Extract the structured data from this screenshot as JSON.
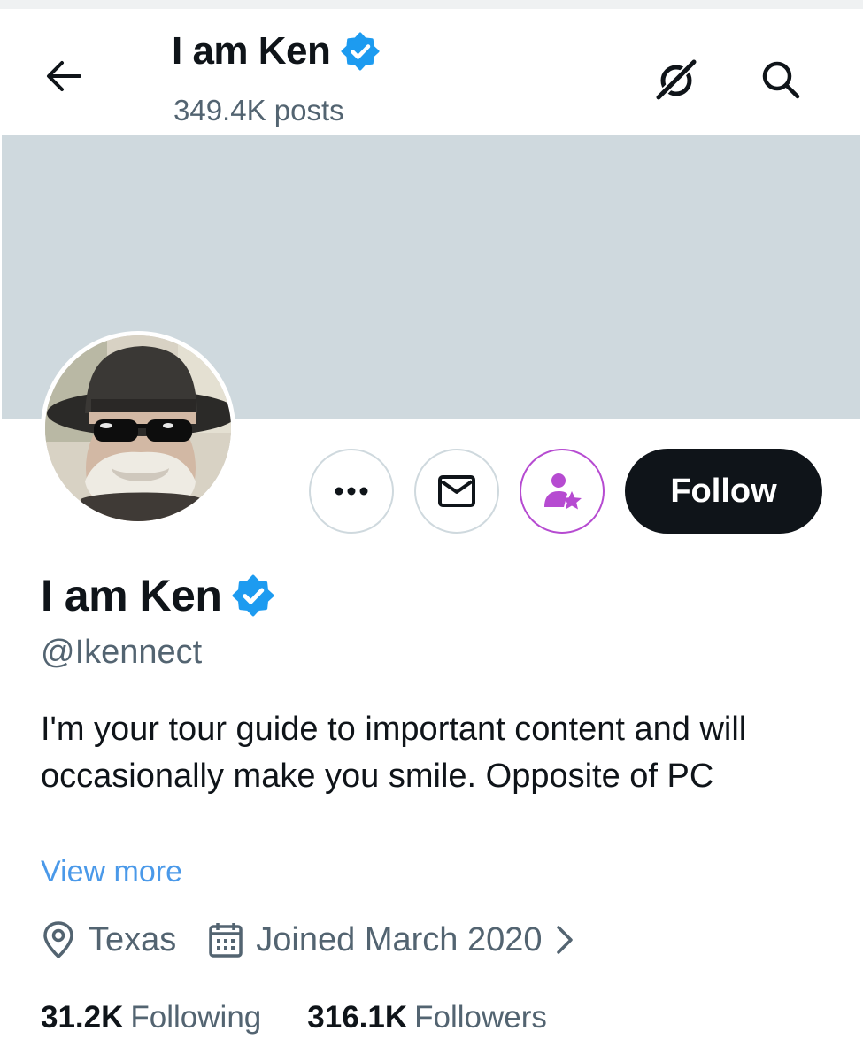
{
  "header": {
    "title": "I am Ken",
    "post_count": "349.4K posts"
  },
  "profile": {
    "display_name": "I am Ken",
    "handle": "@Ikennect",
    "bio": "I'm your tour guide to important content and will occasionally make you smile. Opposite of PC",
    "view_more": "View more",
    "location": "Texas",
    "joined": "Joined March 2020",
    "following_count": "31.2K",
    "following_label": "Following",
    "followers_count": "316.1K",
    "followers_label": "Followers"
  },
  "actions": {
    "follow_label": "Follow",
    "more_icon": "more-horizontal-icon",
    "message_icon": "envelope-icon",
    "subscribe_icon": "subscribe-person-star-icon"
  },
  "icons": {
    "back": "arrow-left-icon",
    "grok": "grok-icon",
    "search": "search-icon",
    "verified": "verified-badge-icon",
    "location": "location-pin-icon",
    "calendar": "calendar-icon"
  },
  "colors": {
    "verified_blue": "#1d9bf0",
    "link_blue": "#4a99e9",
    "subscribe_purple": "#b64bd1",
    "banner_gray": "#cfd9de",
    "follow_button": "#0f1419",
    "secondary_text": "#536471"
  }
}
